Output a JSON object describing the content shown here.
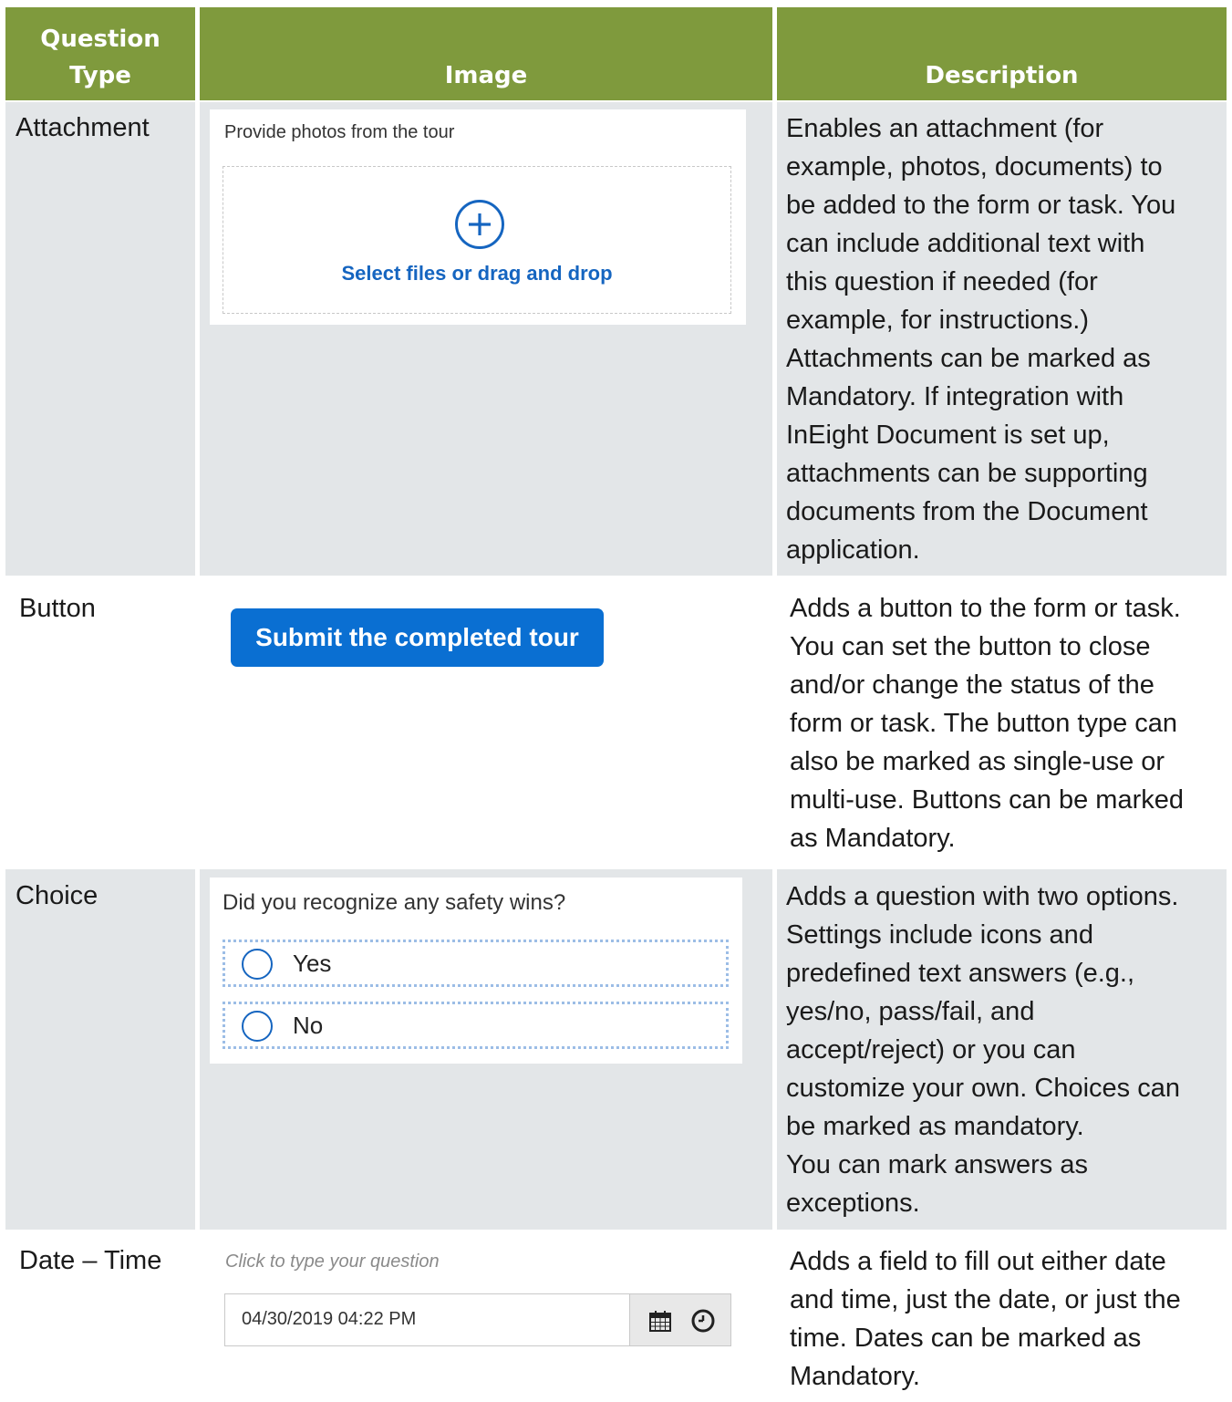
{
  "header": {
    "question_type": "Question\nType",
    "image": "Image",
    "description": "Description"
  },
  "rows": [
    {
      "type": "Attachment",
      "widget": {
        "label": "Provide photos from the tour",
        "icon": "plus-circle-icon",
        "drop_text": "Select files or drag and drop"
      },
      "description_lines": [
        "Enables an attachment (for",
        "example, photos, documents) to",
        "be added to the form or task. You",
        "can include additional text with",
        "this question if needed (for",
        "example, for instructions.)",
        "Attachments can be marked as",
        "Mandatory. If integration with",
        "InEight Document is set up,",
        "attachments can be supporting",
        "documents from the Document",
        "application."
      ]
    },
    {
      "type": "Button",
      "widget": {
        "button_label": "Submit the completed tour"
      },
      "description_lines": [
        "Adds a button to the form or task.",
        "You can set the button to close",
        "and/or change the status of the",
        "form or task. The button type can",
        "also be marked as single-use or",
        "multi-use. Buttons can be marked",
        "as Mandatory."
      ]
    },
    {
      "type": "Choice",
      "widget": {
        "question": "Did you recognize any safety wins?",
        "options": [
          "Yes",
          "No"
        ]
      },
      "description_lines": [
        "Adds a question with two options.",
        "Settings include icons and",
        "predefined text answers (e.g.,",
        "yes/no, pass/fail, and",
        "accept/reject) or you can",
        "customize your own. Choices can",
        "be marked as mandatory.",
        "You can mark answers as",
        "exceptions."
      ]
    },
    {
      "type": "Date – Time",
      "widget": {
        "placeholder": "Click to type your question",
        "value": "04/30/2019 04:22 PM",
        "icons": [
          "calendar-icon",
          "clock-icon"
        ]
      },
      "description_lines": [
        "Adds a field to fill out either date",
        "and time, just the date, or just the",
        "time. Dates can be marked as",
        "Mandatory."
      ]
    }
  ],
  "colors": {
    "header_bg": "#7f9a3d",
    "row_bg": "#e3e6e8",
    "accent_blue": "#0a6fd2"
  }
}
